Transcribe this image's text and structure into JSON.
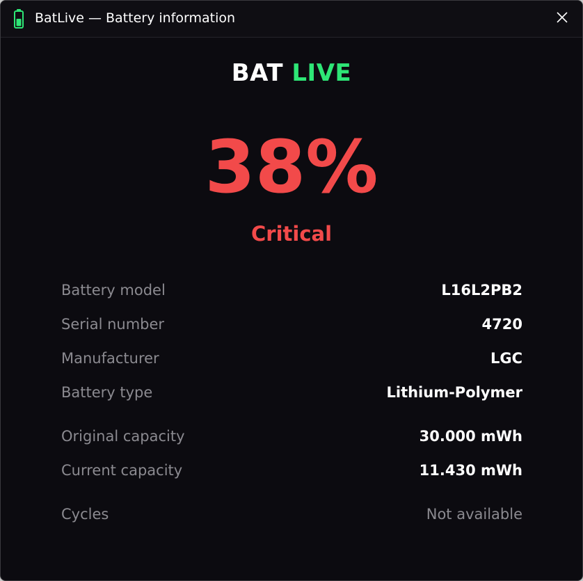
{
  "window": {
    "title": "BatLive — Battery information",
    "icon": "battery-icon",
    "close_icon": "close-icon"
  },
  "brand": {
    "part1": "BAT",
    "part2": "LIVE",
    "accent_color": "#2ee676"
  },
  "battery": {
    "percent": "38%",
    "status": "Critical",
    "status_color": "#f24a4a"
  },
  "details": [
    {
      "label": "Battery model",
      "value": "L16L2PB2"
    },
    {
      "label": "Serial number",
      "value": "4720"
    },
    {
      "label": "Manufacturer",
      "value": "LGC"
    },
    {
      "label": "Battery type",
      "value": "Lithium-Polymer"
    },
    {
      "label": "Original capacity",
      "value": "30.000 mWh"
    },
    {
      "label": "Current capacity",
      "value": "11.430 mWh"
    },
    {
      "label": "Cycles",
      "value": "Not available"
    }
  ]
}
